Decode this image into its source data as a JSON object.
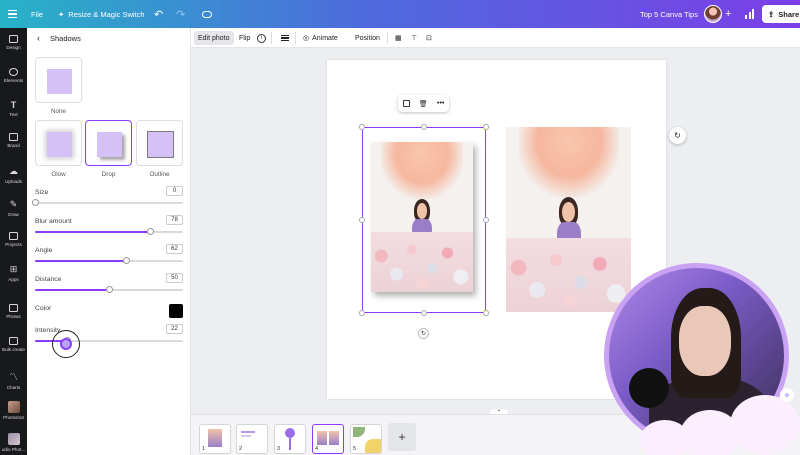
{
  "topbar": {
    "file_label": "File",
    "resize_label": "Resize & Magic Switch",
    "doc_title": "Top 5 Canva Tips",
    "share_label": "Share"
  },
  "rail": {
    "items": [
      {
        "label": "Design",
        "icon": "layout-icon"
      },
      {
        "label": "Elements",
        "icon": "shapes-icon"
      },
      {
        "label": "Text",
        "icon": "text-icon"
      },
      {
        "label": "Brand",
        "icon": "briefcase-icon"
      },
      {
        "label": "Uploads",
        "icon": "upload-icon"
      },
      {
        "label": "Draw",
        "icon": "pen-icon"
      },
      {
        "label": "Projects",
        "icon": "folder-icon"
      },
      {
        "label": "Apps",
        "icon": "grid-icon"
      },
      {
        "label": "Photos",
        "icon": "image-icon"
      },
      {
        "label": "Bulk create",
        "icon": "bulk-icon"
      },
      {
        "label": "Charts",
        "icon": "chart-icon"
      },
      {
        "label": "Photoshot",
        "icon": "app-thumb-icon"
      },
      {
        "label": "udio Phot...",
        "icon": "app-thumb-icon"
      }
    ]
  },
  "panel": {
    "title": "Shadows",
    "presets": [
      {
        "label": "None"
      },
      {
        "label": "Glow"
      },
      {
        "label": "Drop",
        "selected": true
      },
      {
        "label": "Outline"
      }
    ],
    "sliders": [
      {
        "label": "Size",
        "value": "0",
        "fraction": 0.0
      },
      {
        "label": "Blur amount",
        "value": "78",
        "fraction": 0.78
      },
      {
        "label": "Angle",
        "value": "62",
        "fraction": 0.62
      },
      {
        "label": "Distance",
        "value": "50",
        "fraction": 0.5
      },
      {
        "label": "Intensity",
        "value": "22",
        "fraction": 0.22
      }
    ],
    "color_label": "Color",
    "color_value": "#000000"
  },
  "context_toolbar": {
    "edit_photo": "Edit photo",
    "flip": "Flip",
    "animate": "Animate",
    "position": "Position"
  },
  "pages": [
    {
      "number": "1"
    },
    {
      "number": "2"
    },
    {
      "number": "3"
    },
    {
      "number": "4",
      "selected": true
    },
    {
      "number": "5"
    }
  ],
  "colors": {
    "accent": "#8b3dff",
    "topbar_start": "#27b3c7",
    "topbar_end": "#7c3ee8"
  }
}
